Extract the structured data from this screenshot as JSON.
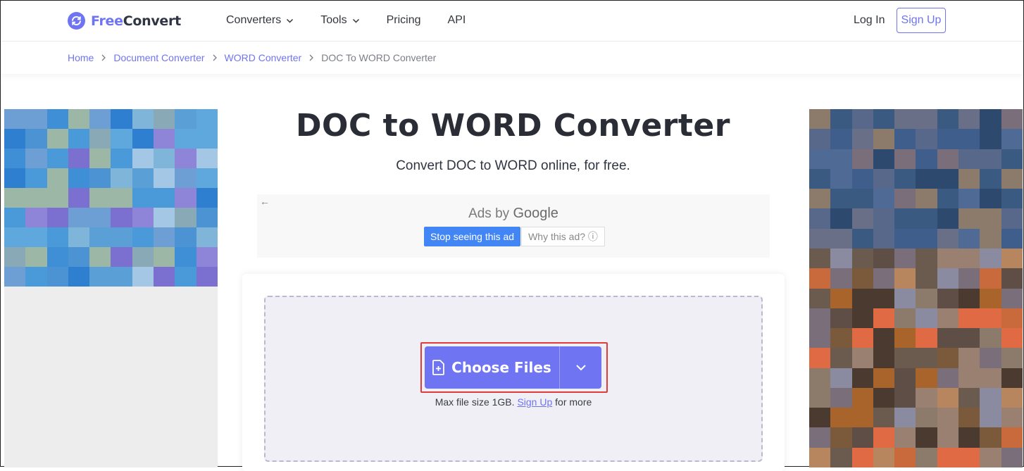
{
  "header": {
    "logo_free": "Free",
    "logo_convert": "Convert",
    "nav": [
      {
        "label": "Converters",
        "has_dropdown": true
      },
      {
        "label": "Tools",
        "has_dropdown": true
      },
      {
        "label": "Pricing",
        "has_dropdown": false
      },
      {
        "label": "API",
        "has_dropdown": false
      }
    ],
    "login": "Log In",
    "signup": "Sign Up"
  },
  "breadcrumb": [
    "Home",
    "Document Converter",
    "WORD Converter",
    "DOC To WORD Converter"
  ],
  "page": {
    "title": "DOC to WORD Converter",
    "subtitle": "Convert DOC to WORD online, for free."
  },
  "google_ad": {
    "back": "←",
    "ads_by": "Ads by",
    "google": "Google",
    "stop": "Stop seeing this ad",
    "why": "Why this ad? ⓘ"
  },
  "upload": {
    "choose_files": "Choose Files",
    "limit_prefix": "Max file size 1GB.",
    "limit_link": "Sign Up",
    "limit_suffix": "for more"
  },
  "colors": {
    "accent": "#6f74f2",
    "highlight": "#e23b3b",
    "google_blue": "#4285f4"
  }
}
